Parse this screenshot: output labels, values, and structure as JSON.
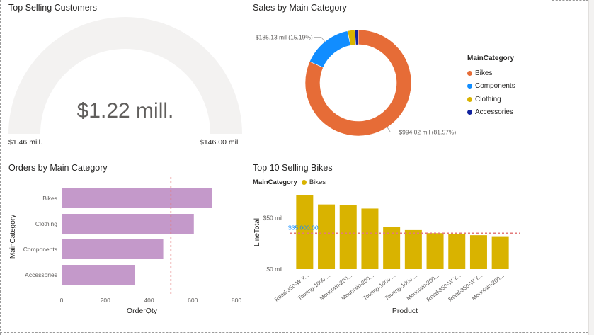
{
  "gauge": {
    "title": "Top Selling Customers",
    "value_label": "$1.22 mill.",
    "min_label": "$1.46 mill.",
    "max_label": "$146.00 mil",
    "track_color": "#f3f2f1"
  },
  "chart_data": [
    {
      "type": "pie",
      "title": "Sales by Main Category",
      "donut": true,
      "legend": {
        "title": "MainCategory",
        "position": "right"
      },
      "labels": [
        "Bikes",
        "Components",
        "Clothing",
        "Accessories"
      ],
      "values": [
        81.57,
        15.19,
        2.2,
        1.04
      ],
      "colors": [
        "#e66c37",
        "#118dff",
        "#d9b300",
        "#12239e"
      ],
      "data_labels": [
        {
          "category": "Components",
          "text": "$185.13 mil (15.19%)"
        },
        {
          "category": "Bikes",
          "text": "$994.02 mil (81.57%)"
        }
      ]
    },
    {
      "type": "bar",
      "orientation": "horizontal",
      "title": "Orders by Main Category",
      "categories": [
        "Bikes",
        "Clothing",
        "Components",
        "Accessories"
      ],
      "values": [
        688,
        605,
        465,
        335
      ],
      "xlabel": "OrderQty",
      "ylabel": "MainCategory",
      "xlim": [
        0,
        800
      ],
      "xticks": [
        0,
        200,
        400,
        600,
        800
      ],
      "reference_line": 500,
      "bar_color": "#c499ca",
      "grid": false
    },
    {
      "type": "bar",
      "title": "Top 10 Selling Bikes",
      "legend": {
        "title": "MainCategory",
        "position": "top-left"
      },
      "series": [
        {
          "name": "Bikes",
          "color": "#d9b300"
        }
      ],
      "categories": [
        "Road-350-W Y...",
        "Touring-1000 ...",
        "Mountain-200...",
        "Mountain-200...",
        "Touring-1000 ...",
        "Touring-1000 ...",
        "Mountain-200...",
        "Road-350-W Y...",
        "Road-350-W Y...",
        "Mountain-200..."
      ],
      "values": [
        72,
        63,
        62.5,
        59,
        41,
        38,
        35,
        34.5,
        33,
        32
      ],
      "xlabel": "Product",
      "ylabel": "LineTotal",
      "ylim": [
        0,
        80
      ],
      "yticks": [
        {
          "value": 0,
          "label": "$0 mil"
        },
        {
          "value": 50,
          "label": "$50 mil"
        }
      ],
      "reference_line": {
        "value": 35,
        "label": "$35,000.00"
      },
      "grid": false
    }
  ]
}
